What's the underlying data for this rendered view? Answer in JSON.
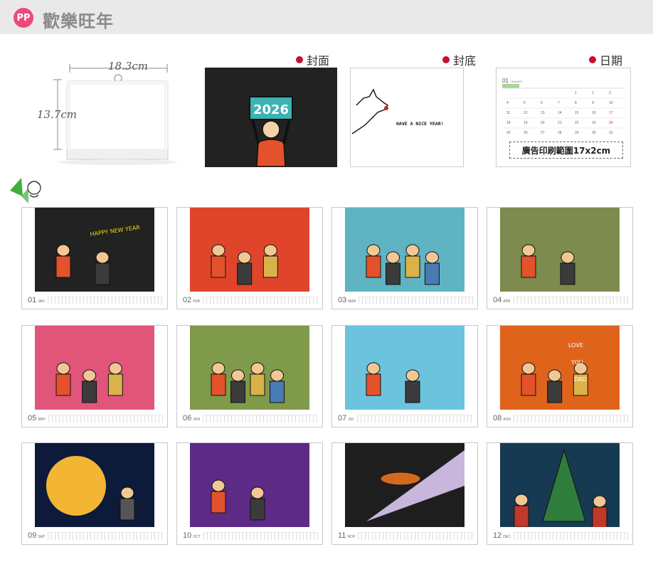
{
  "header": {
    "logo": "PP",
    "title": "歡樂旺年"
  },
  "dimensions": {
    "width": "18.3cm",
    "height": "13.7cm"
  },
  "sections": {
    "cover": "封面",
    "back": "封底",
    "date": "日期"
  },
  "cover": {
    "year": "2026"
  },
  "back": {
    "greeting": "HAVE A NICE YEAR!"
  },
  "date_page": {
    "month_num": "01",
    "month_name": "JANUARY",
    "ad_text": "廣告印刷範圍17x2cm"
  },
  "months": [
    {
      "num": "01",
      "name": "JAN",
      "bg": "#222222"
    },
    {
      "num": "02",
      "name": "FEB",
      "bg": "#e0452c"
    },
    {
      "num": "03",
      "name": "MAR",
      "bg": "#5fb3c2"
    },
    {
      "num": "04",
      "name": "APR",
      "bg": "#7d8b4e"
    },
    {
      "num": "05",
      "name": "MAY",
      "bg": "#e2557b"
    },
    {
      "num": "06",
      "name": "JUN",
      "bg": "#7f9a4a"
    },
    {
      "num": "07",
      "name": "JUL",
      "bg": "#6cc3dd"
    },
    {
      "num": "08",
      "name": "AUG",
      "bg": "#e0631c"
    },
    {
      "num": "09",
      "name": "SEP",
      "bg": "#0d1a3a"
    },
    {
      "num": "10",
      "name": "OCT",
      "bg": "#5d2a86"
    },
    {
      "num": "11",
      "name": "NOV",
      "bg": "#1e1e1e"
    },
    {
      "num": "12",
      "name": "DEC",
      "bg": "#163a52"
    }
  ],
  "art_text": {
    "jan_sign": "HAPPY NEW YEAR",
    "aug_words": [
      "LOVE",
      "YOU",
      "DAD"
    ]
  }
}
